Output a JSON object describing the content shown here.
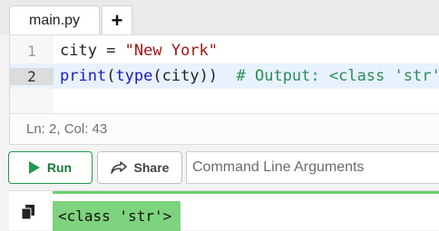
{
  "tabs": [
    {
      "label": "main.py"
    }
  ],
  "add_tab_label": "+",
  "editor": {
    "lines": [
      {
        "number": "1",
        "tokens": [
          "city = ",
          "\"New York\""
        ]
      },
      {
        "number": "2",
        "tokens": [
          "print",
          "(",
          "type",
          "(city))  ",
          "# Output: <class 'str'>"
        ]
      }
    ],
    "status": "Ln: 2,  Col: 43"
  },
  "toolbar": {
    "run_label": "Run",
    "share_label": "Share",
    "args_placeholder": "Command Line Arguments"
  },
  "output": {
    "text": "<class 'str'>"
  },
  "colors": {
    "run_accent": "#1e9b4a",
    "output_highlight": "#7ed37e",
    "keyword": "#1b1bbf",
    "string": "#a31515",
    "comment": "#2e8b57"
  },
  "icons": [
    "play-icon",
    "share-arrow-icon",
    "copy-icon"
  ]
}
